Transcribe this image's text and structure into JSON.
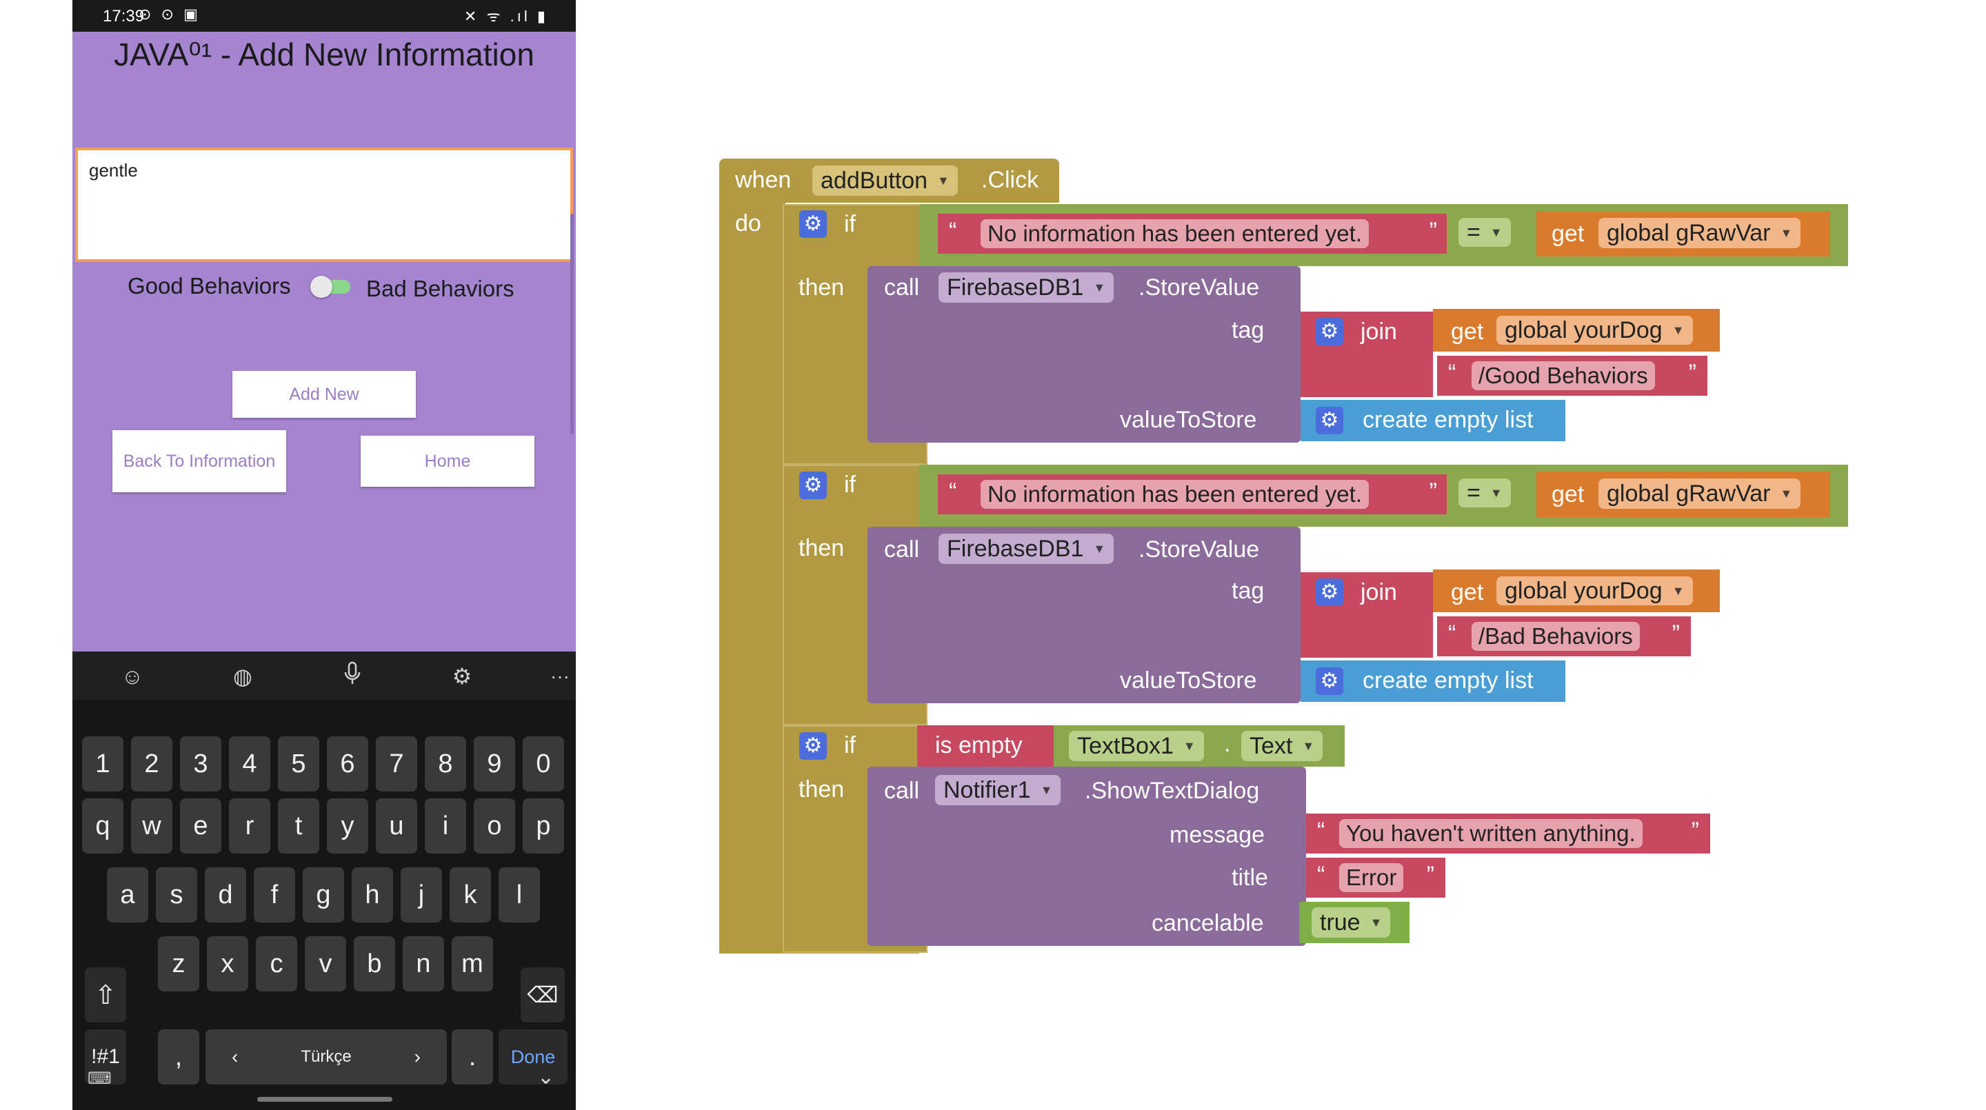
{
  "colors": {
    "app_bg": "#a584d0",
    "event_block": "#b29a43",
    "control_block": "#8ca84c",
    "component_block": "#8a6b9a",
    "text_block": "#c7495f",
    "variable_block": "#d97a2c",
    "list_block": "#4a9ed6",
    "logic_block": "#7fae46"
  },
  "phone": {
    "status": {
      "time": "17:39",
      "left_icons": "⊙ ⊙ ▣",
      "right_icons": "✕ ᯤ .ıl ▮"
    },
    "title": "JAVA⁰¹ - Add New Information",
    "textbox_value": "gentle",
    "good_label": "Good Behaviors",
    "bad_label": "Bad Behaviors",
    "add_button": "Add New",
    "back_button": "Back To Information",
    "home_button": "Home",
    "keyboard": {
      "toolbar_icons": [
        "smiley-icon",
        "sticker-icon",
        "microphone-icon",
        "settings-icon",
        "more-icon"
      ],
      "row_numbers": [
        "1",
        "2",
        "3",
        "4",
        "5",
        "6",
        "7",
        "8",
        "9",
        "0"
      ],
      "row_q": [
        "q",
        "w",
        "e",
        "r",
        "t",
        "y",
        "u",
        "i",
        "o",
        "p"
      ],
      "row_a": [
        "a",
        "s",
        "d",
        "f",
        "g",
        "h",
        "j",
        "k",
        "l"
      ],
      "row_z": [
        "z",
        "x",
        "c",
        "v",
        "b",
        "n",
        "m"
      ],
      "symbols_key": "!#1",
      "comma_key": ",",
      "space_language": "Türkçe",
      "space_left": "‹",
      "space_right": "›",
      "period_key": ".",
      "done_key": "Done"
    }
  },
  "blocks": {
    "event": {
      "when": "when",
      "component": "addButton",
      "event": ".Click",
      "do": "do"
    },
    "if1": {
      "if": "if",
      "then": "then",
      "string": "No information has been entered yet.",
      "op": "=",
      "get": "get",
      "var": "global gRawVar",
      "call": "call",
      "component": "FirebaseDB1",
      "method": ".StoreValue",
      "tag": "tag",
      "join": "join",
      "get2": "get",
      "var2": "global yourDog",
      "suffix": "/Good Behaviors",
      "value_to_store": "valueToStore",
      "list": "create empty list"
    },
    "if2": {
      "if": "if",
      "then": "then",
      "string": "No information has been entered yet.",
      "op": "=",
      "get": "get",
      "var": "global gRawVar",
      "call": "call",
      "component": "FirebaseDB1",
      "method": ".StoreValue",
      "tag": "tag",
      "join": "join",
      "get2": "get",
      "var2": "global yourDog",
      "suffix": "/Bad Behaviors",
      "value_to_store": "valueToStore",
      "list": "create empty list"
    },
    "if3": {
      "if": "if",
      "then": "then",
      "is_empty": "is empty",
      "component": "TextBox1",
      "dot": ".",
      "property": "Text",
      "call": "call",
      "notifier": "Notifier1",
      "method": ".ShowTextDialog",
      "message": "message",
      "message_value": "You haven't written anything.",
      "title": "title",
      "title_value": "Error",
      "cancelable": "cancelable",
      "cancelable_value": "true"
    }
  }
}
